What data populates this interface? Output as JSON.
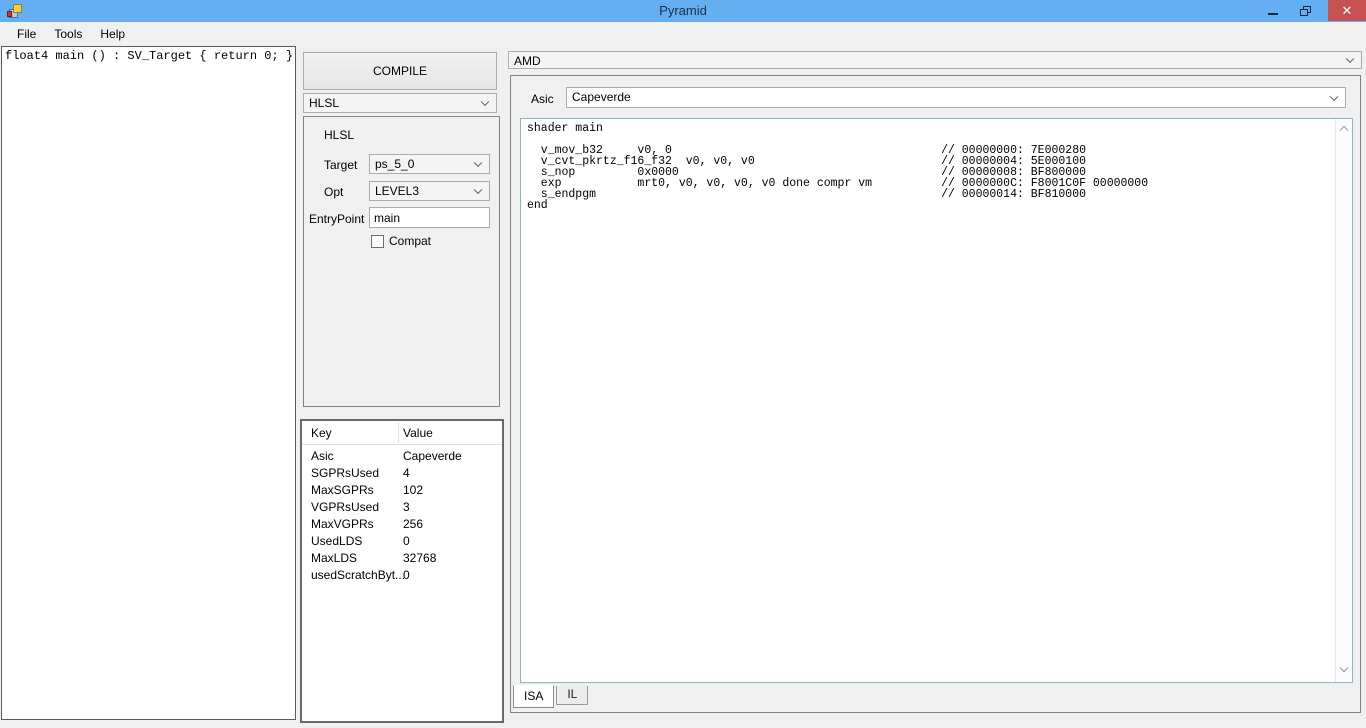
{
  "window": {
    "title": "Pyramid",
    "close_glyph": "✕"
  },
  "menu": {
    "items": [
      {
        "label": "File"
      },
      {
        "label": "Tools"
      },
      {
        "label": "Help"
      }
    ]
  },
  "editor": {
    "text": "float4 main () : SV_Target { return 0; }"
  },
  "toolbar": {
    "compile_label": "COMPILE",
    "language_selected": "HLSL"
  },
  "hlsl_options": {
    "group_label": "HLSL",
    "target_label": "Target",
    "target_value": "ps_5_0",
    "opt_label": "Opt",
    "opt_value": "LEVEL3",
    "entrypoint_label": "EntryPoint",
    "entrypoint_value": "main",
    "compat_label": "Compat",
    "compat_checked": false
  },
  "stats": {
    "columns": [
      "Key",
      "Value"
    ],
    "rows": [
      {
        "key": "Asic",
        "value": "Capeverde"
      },
      {
        "key": "SGPRsUsed",
        "value": "4"
      },
      {
        "key": "MaxSGPRs",
        "value": "102"
      },
      {
        "key": "VGPRsUsed",
        "value": "3"
      },
      {
        "key": "MaxVGPRs",
        "value": "256"
      },
      {
        "key": "UsedLDS",
        "value": "0"
      },
      {
        "key": "MaxLDS",
        "value": "32768"
      },
      {
        "key": "usedScratchByt...",
        "value": "0"
      }
    ]
  },
  "backend": {
    "selected": "AMD",
    "asic_label": "Asic",
    "asic_value": "Capeverde"
  },
  "disassembly": {
    "lines": [
      "shader main",
      "",
      "  v_mov_b32     v0, 0                                       // 00000000: 7E000280",
      "  v_cvt_pkrtz_f16_f32  v0, v0, v0                           // 00000004: 5E000100",
      "  s_nop         0x0000                                      // 00000008: BF800000",
      "  exp           mrt0, v0, v0, v0, v0 done compr vm          // 0000000C: F8001C0F 00000000",
      "  s_endpgm                                                  // 00000014: BF810000",
      "end"
    ]
  },
  "tabs": [
    {
      "label": "ISA",
      "selected": true
    },
    {
      "label": "IL",
      "selected": false
    }
  ],
  "colors": {
    "titlebar": "#63aff2",
    "close_button": "#c75050",
    "window_bg": "#f0f0f0",
    "disasm_border": "#8ab4c8"
  }
}
